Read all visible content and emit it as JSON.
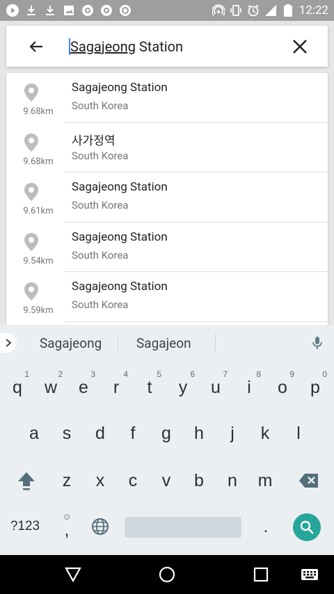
{
  "statusbar": {
    "time": "12:22",
    "left_icons": [
      "play-icon",
      "download-icon",
      "download-icon",
      "image-icon",
      "notification-icon",
      "notification-icon",
      "notification-icon"
    ],
    "right_icons": [
      "hotspot-icon",
      "vibrate-icon",
      "alarm-icon",
      "signal-icon",
      "battery-icon"
    ]
  },
  "search": {
    "value_underlined": "Sagajeong",
    "value_rest": " Station"
  },
  "results": [
    {
      "title": "Sagajeong Station",
      "subtitle": "South Korea",
      "distance": "9.68km"
    },
    {
      "title": "사가정역",
      "subtitle": "South Korea",
      "distance": "9.68km"
    },
    {
      "title": "Sagajeong Station",
      "subtitle": "South Korea",
      "distance": "9.61km"
    },
    {
      "title": "Sagajeong Station",
      "subtitle": "South Korea",
      "distance": "9.54km"
    },
    {
      "title": "Sagajeong Station",
      "subtitle": "South Korea",
      "distance": "9.59km"
    }
  ],
  "suggestions": [
    "Sagajeong",
    "Sagajeon"
  ],
  "keyboard": {
    "row1": [
      {
        "k": "q",
        "h": "1"
      },
      {
        "k": "w",
        "h": "2"
      },
      {
        "k": "e",
        "h": "3"
      },
      {
        "k": "r",
        "h": "4"
      },
      {
        "k": "t",
        "h": "5"
      },
      {
        "k": "y",
        "h": "6"
      },
      {
        "k": "u",
        "h": "7"
      },
      {
        "k": "i",
        "h": "8"
      },
      {
        "k": "o",
        "h": "9"
      },
      {
        "k": "p",
        "h": "0"
      }
    ],
    "row2": [
      "a",
      "s",
      "d",
      "f",
      "g",
      "h",
      "j",
      "k",
      "l"
    ],
    "row3": [
      "z",
      "x",
      "c",
      "v",
      "b",
      "n",
      "m"
    ],
    "symbols_label": "?123",
    "comma": ",",
    "period": "."
  },
  "colors": {
    "accent": "#26a69a",
    "caret": "#4285f4"
  }
}
